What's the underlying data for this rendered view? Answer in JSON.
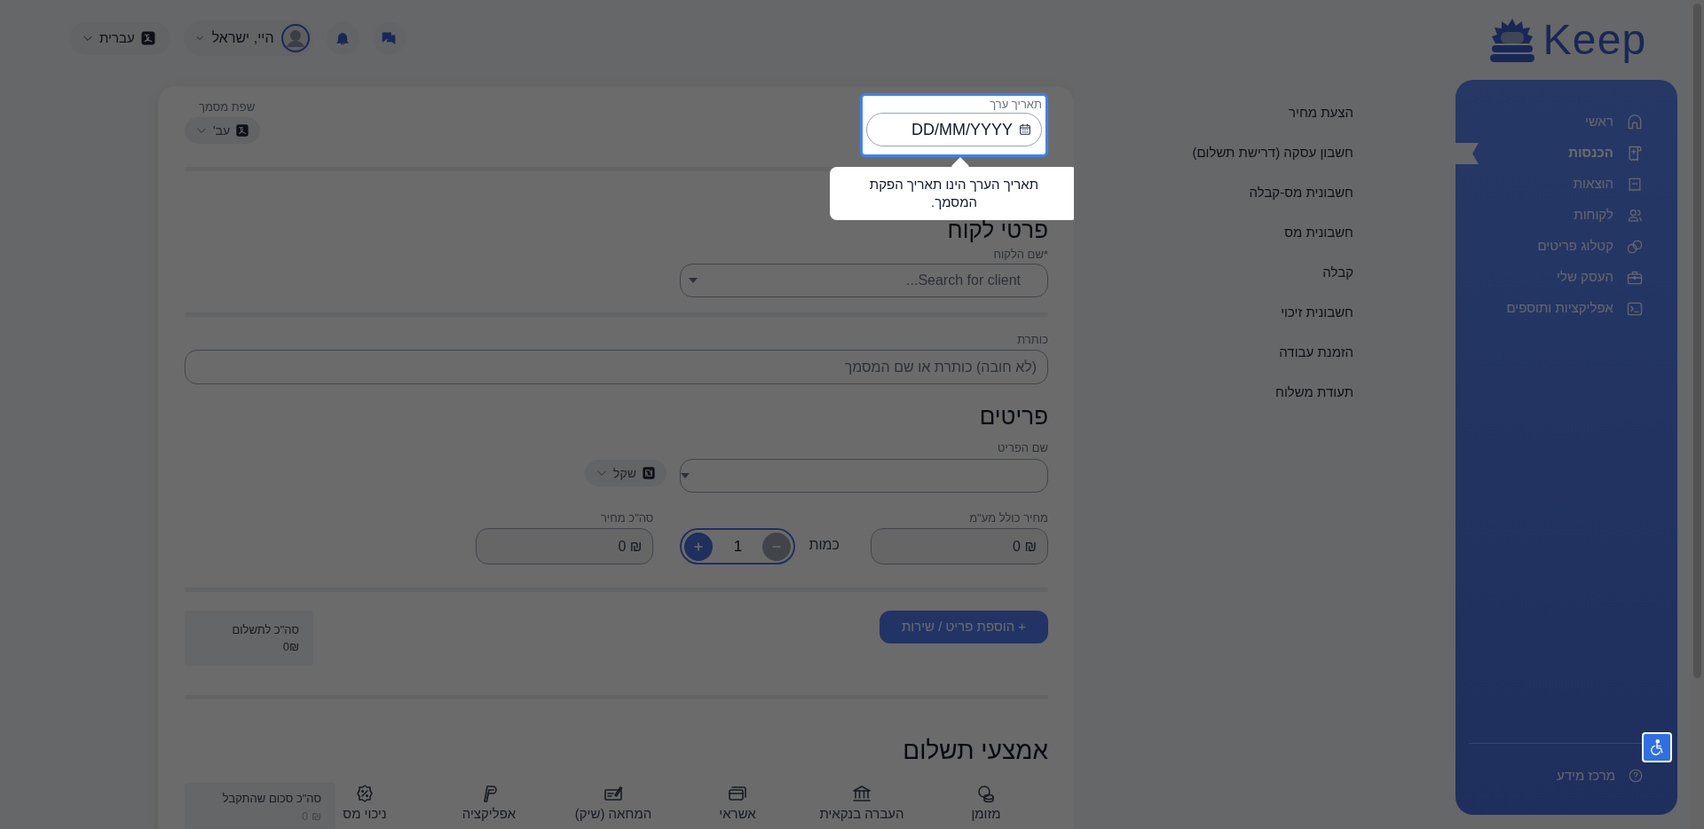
{
  "logo": {
    "text": "Keep"
  },
  "header": {
    "language": "עברית",
    "greeting": "היי, ישראל"
  },
  "sidebar": {
    "items": [
      {
        "label": "ראשי",
        "kind": "home",
        "selected": false
      },
      {
        "label": "הכנסות",
        "kind": "income",
        "selected": true
      },
      {
        "label": "הוצאות",
        "kind": "expenses",
        "selected": false
      },
      {
        "label": "לקוחות",
        "kind": "clients",
        "selected": false
      },
      {
        "label": "קטלוג פריטים",
        "kind": "catalog",
        "selected": false
      },
      {
        "label": "העסק שלי",
        "kind": "business",
        "selected": false
      },
      {
        "label": "אפליקציות ותוספים",
        "kind": "apps",
        "selected": false
      }
    ],
    "help": "מרכז מידע"
  },
  "document_types": [
    "הצעת מחיר",
    "חשבון עסקה (דרישת תשלום)",
    "חשבונית מס-קבלה",
    "חשבונית מס",
    "קבלה",
    "חשבונית זיכוי",
    "הזמנת עבודה",
    "תעודת משלוח"
  ],
  "form": {
    "date": {
      "label": "תאריך ערך",
      "placeholder": "DD/MM/YYYY"
    },
    "tooltip": "תאריך הערך הינו תאריך הפקת המסמך.",
    "doc_language": {
      "label": "שפת מסמך",
      "value": "עב'"
    },
    "client": {
      "heading": "פרטי לקוח",
      "label": "*שם הלקוח",
      "placeholder": "Search for client..."
    },
    "title": {
      "label": "כותרת",
      "placeholder": "(לא חובה) כותרת או שם המסמך"
    },
    "items": {
      "heading": "פריטים",
      "name_label": "שם הפריט",
      "currency": "שקל",
      "price_label": "מחיר כולל מע\"מ",
      "price": "₪ 0",
      "quantity_label": "כמות",
      "quantity": "1",
      "total_label": "סה\"כ מחיר",
      "total": "₪ 0",
      "add_button": "+ הוספת פריט / שירות"
    },
    "summary": {
      "label": "סה\"כ לתשלום",
      "value": "0₪"
    },
    "payment": {
      "heading": "אמצעי תשלום",
      "methods": [
        {
          "kind": "cash",
          "label": "מזומן"
        },
        {
          "kind": "bank",
          "label": "העברה בנקאית"
        },
        {
          "kind": "card",
          "label": "אשראי"
        },
        {
          "kind": "check",
          "label": "המחאה (שיק)"
        },
        {
          "kind": "app",
          "label": "אפליקציה"
        },
        {
          "kind": "tax",
          "label": "ניכוי מס"
        }
      ],
      "received_label": "סה\"כ סכום שהתקבל",
      "received": "₪ 0"
    }
  }
}
